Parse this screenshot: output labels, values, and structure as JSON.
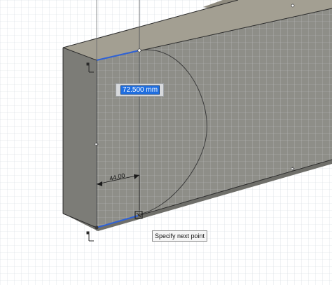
{
  "canvas": {
    "background": "#ffffff",
    "grid_color": "#c9ced6",
    "face_front_color": "#8e8e88",
    "face_top_color": "#a39f92",
    "face_side_color": "#7c7c77"
  },
  "dimension_input": {
    "value": "72.500 mm",
    "highlight_color": "#1f6ee0"
  },
  "dimension_label": {
    "text": "44.00"
  },
  "tooltip": {
    "text": "Specify next point"
  },
  "icons": {
    "sketch_origin_top": "coordinate-axis-icon",
    "sketch_origin_bottom": "coordinate-axis-icon",
    "endpoint": "cursor-square-icon"
  },
  "accent_colors": {
    "selected_edge": "#2f62d6",
    "sketch_line": "#3b3b3b"
  }
}
